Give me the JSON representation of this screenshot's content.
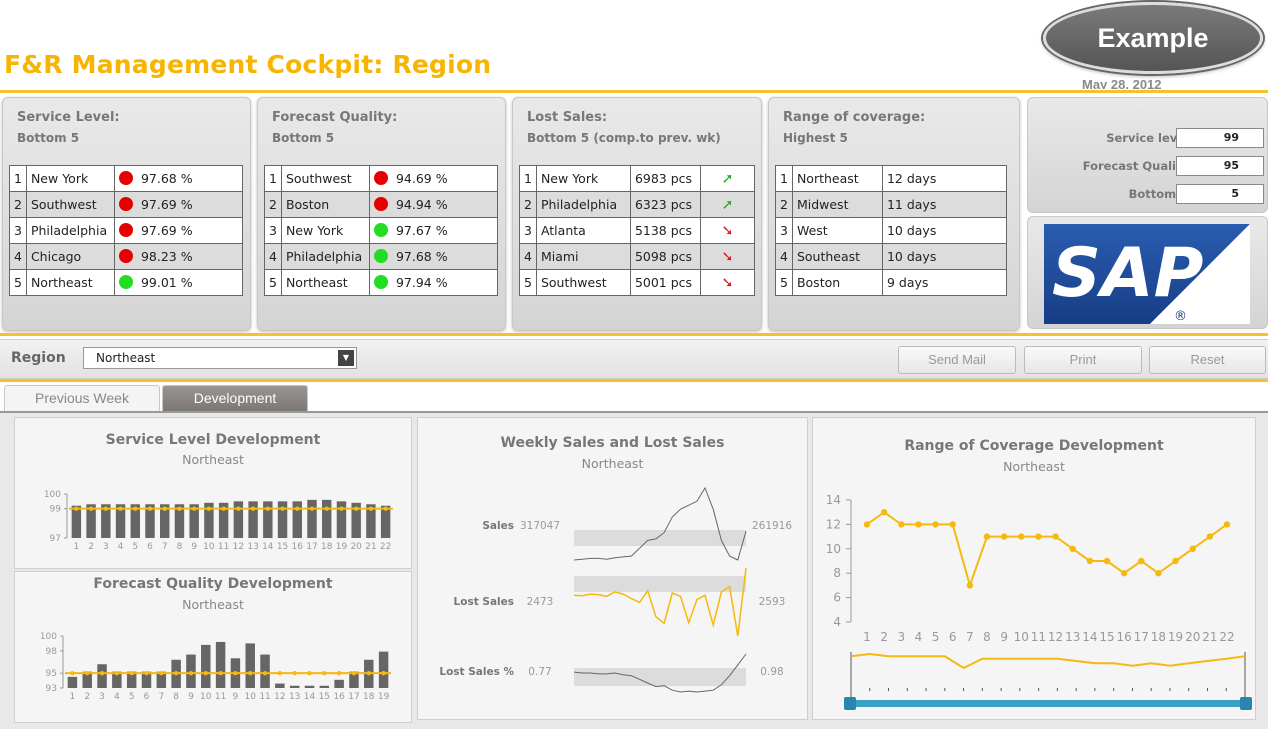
{
  "header": {
    "title": "F&R Management Cockpit: Region",
    "badge": "Example",
    "date": "May 28, 2012"
  },
  "colors": {
    "accent": "#f7b500",
    "red_status": "#e60000",
    "green_status": "#22dd22",
    "chart_bar": "#666666",
    "chart_line": "#f5b90f"
  },
  "kpis": {
    "service_level": {
      "title": "Service Level:",
      "subtitle": "Bottom 5",
      "rows": [
        {
          "rank": "1",
          "name": "New York",
          "status": "red",
          "value": "97.68 %"
        },
        {
          "rank": "2",
          "name": "Southwest",
          "status": "red",
          "value": "97.69 %"
        },
        {
          "rank": "3",
          "name": "Philadelphia",
          "status": "red",
          "value": "97.69 %"
        },
        {
          "rank": "4",
          "name": "Chicago",
          "status": "red",
          "value": "98.23 %"
        },
        {
          "rank": "5",
          "name": "Northeast",
          "status": "green",
          "value": "99.01 %"
        }
      ]
    },
    "forecast_quality": {
      "title": "Forecast Quality:",
      "subtitle": "Bottom 5",
      "rows": [
        {
          "rank": "1",
          "name": "Southwest",
          "status": "red",
          "value": "94.69 %"
        },
        {
          "rank": "2",
          "name": "Boston",
          "status": "red",
          "value": "94.94 %"
        },
        {
          "rank": "3",
          "name": "New York",
          "status": "green",
          "value": "97.67 %"
        },
        {
          "rank": "4",
          "name": "Philadelphia",
          "status": "green",
          "value": "97.68 %"
        },
        {
          "rank": "5",
          "name": "Northeast",
          "status": "green",
          "value": "97.94 %"
        }
      ]
    },
    "lost_sales": {
      "title": "Lost Sales:",
      "subtitle": "Bottom 5 (comp.to prev. wk)",
      "rows": [
        {
          "rank": "1",
          "name": "New York",
          "value": "6983 pcs",
          "trend": "up"
        },
        {
          "rank": "2",
          "name": "Philadelphia",
          "value": "6323 pcs",
          "trend": "up"
        },
        {
          "rank": "3",
          "name": "Atlanta",
          "value": "5138 pcs",
          "trend": "down"
        },
        {
          "rank": "4",
          "name": "Miami",
          "value": "5098 pcs",
          "trend": "down"
        },
        {
          "rank": "5",
          "name": "Southwest",
          "value": "5001 pcs",
          "trend": "down"
        }
      ]
    },
    "range_of_coverage": {
      "title": "Range of coverage:",
      "subtitle": "Highest 5",
      "rows": [
        {
          "rank": "1",
          "name": "Northeast",
          "value": "12 days"
        },
        {
          "rank": "2",
          "name": "Midwest",
          "value": "11 days"
        },
        {
          "rank": "3",
          "name": "West",
          "value": "10 days"
        },
        {
          "rank": "4",
          "name": "Southeast",
          "value": "10 days"
        },
        {
          "rank": "5",
          "name": "Boston",
          "value": "9 days"
        }
      ]
    }
  },
  "settings": {
    "service_level_label": "Service level",
    "service_level_value": "99",
    "forecast_quality_label": "Forecast Quality",
    "forecast_quality_value": "95",
    "bottom_x_label": "Bottom X",
    "bottom_x_value": "5"
  },
  "logo": {
    "text": "SAP",
    "mark": "®"
  },
  "toolbar": {
    "region_label": "Region",
    "region_value": "Northeast",
    "send_mail": "Send Mail",
    "print": "Print",
    "reset": "Reset"
  },
  "tabs": {
    "previous_week": "Previous Week",
    "development": "Development",
    "active": "development"
  },
  "charts": {
    "service_level_dev": {
      "title": "Service Level Development",
      "subtitle": "Northeast"
    },
    "forecast_quality_dev": {
      "title": "Forecast Quality Development",
      "subtitle": "Northeast"
    },
    "weekly_sales": {
      "title": "Weekly Sales and Lost Sales",
      "subtitle": "Northeast",
      "rows": [
        {
          "label": "Sales",
          "start": "317047",
          "end": "261916"
        },
        {
          "label": "Lost Sales",
          "start": "2473",
          "end": "2593"
        },
        {
          "label": "Lost Sales %",
          "start": "0.77",
          "end": "0.98"
        }
      ]
    },
    "range_dev": {
      "title": "Range of Coverage Development",
      "subtitle": "Northeast"
    }
  },
  "chart_data": [
    {
      "type": "bar",
      "title": "Service Level Development",
      "categories": [
        "1",
        "2",
        "3",
        "4",
        "5",
        "6",
        "7",
        "8",
        "9",
        "10",
        "11",
        "12",
        "13",
        "14",
        "15",
        "16",
        "17",
        "18",
        "19",
        "20",
        "21",
        "22"
      ],
      "values": [
        99.2,
        99.3,
        99.3,
        99.3,
        99.3,
        99.3,
        99.3,
        99.3,
        99.3,
        99.4,
        99.4,
        99.5,
        99.5,
        99.5,
        99.5,
        99.5,
        99.6,
        99.6,
        99.5,
        99.4,
        99.3,
        99.2
      ],
      "target": 99,
      "yticks": [
        "97",
        "99",
        "100"
      ],
      "ylim": [
        97,
        100
      ]
    },
    {
      "type": "bar",
      "title": "Forecast Quality Development",
      "categories": [
        "1",
        "2",
        "3",
        "4",
        "5",
        "6",
        "7",
        "8",
        "9",
        "10",
        "11",
        "9",
        "10",
        "11",
        "12",
        "13",
        "14",
        "15",
        "16",
        "17",
        "18",
        "19"
      ],
      "values": [
        94.5,
        95.2,
        96.2,
        95.2,
        95.2,
        95.2,
        95.2,
        96.8,
        97.5,
        98.8,
        99.2,
        97.0,
        99.0,
        97.5,
        93.6,
        93.3,
        93.3,
        93.3,
        94.1,
        95.2,
        96.8,
        97.9
      ],
      "target": 95,
      "yticks": [
        "93",
        "95",
        "98",
        "100"
      ],
      "ylim": [
        93,
        100
      ]
    },
    {
      "type": "line",
      "title": "Weekly Sales and Lost Sales",
      "series": [
        {
          "name": "Sales",
          "values": [
            225000,
            226000,
            227000,
            227000,
            226000,
            228000,
            229000,
            230000,
            240000,
            250000,
            252000,
            260000,
            280000,
            290000,
            295000,
            300000,
            317047,
            290000,
            250000,
            230000,
            225000,
            261916
          ]
        },
        {
          "name": "Lost Sales",
          "values": [
            2100,
            2090,
            2120,
            2110,
            2080,
            2160,
            2120,
            2040,
            1970,
            2180,
            1710,
            1590,
            2140,
            2080,
            1600,
            2020,
            2100,
            1560,
            2160,
            2250,
            1360,
            2593
          ]
        },
        {
          "name": "Lost Sales %",
          "values": [
            0.78,
            0.77,
            0.77,
            0.76,
            0.76,
            0.77,
            0.75,
            0.74,
            0.7,
            0.66,
            0.62,
            0.63,
            0.58,
            0.56,
            0.57,
            0.56,
            0.57,
            0.58,
            0.64,
            0.74,
            0.86,
            0.98
          ]
        }
      ]
    },
    {
      "type": "line",
      "title": "Range of Coverage Development",
      "categories": [
        "1",
        "2",
        "3",
        "4",
        "5",
        "6",
        "7",
        "8",
        "9",
        "10",
        "11",
        "12",
        "13",
        "14",
        "15",
        "16",
        "17",
        "18",
        "19",
        "20",
        "21",
        "22"
      ],
      "values": [
        12,
        13,
        12,
        12,
        12,
        12,
        7,
        11,
        11,
        11,
        11,
        11,
        10,
        9,
        9,
        8,
        9,
        8,
        9,
        10,
        11,
        12
      ],
      "yticks": [
        "4",
        "6",
        "8",
        "10",
        "12",
        "14"
      ],
      "ylim": [
        4,
        14
      ]
    }
  ]
}
